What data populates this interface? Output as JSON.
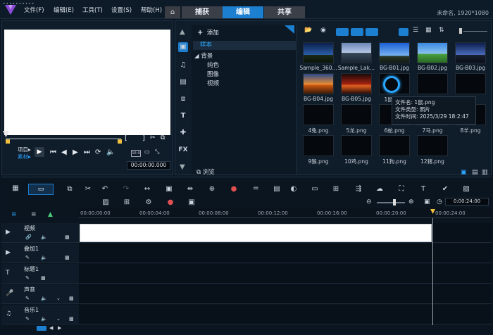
{
  "menubar": {
    "items": [
      "文件(F)",
      "编辑(E)",
      "工具(T)",
      "设置(S)",
      "帮助(H)"
    ],
    "home_icon": "⌂",
    "tabs": [
      "捕获",
      "编辑",
      "共享"
    ],
    "project_info": "未命名, 1920*1080"
  },
  "preview": {
    "mode_project": "项目▸",
    "mode_clip": "素材▸",
    "timecode": "00:00:00.000",
    "grip": "••••••••••",
    "bracket_in": "[",
    "bracket_out": "]"
  },
  "library": {
    "add_label": "添加",
    "tree": [
      "样本",
      "背景",
      "纯色",
      "图像",
      "视频"
    ],
    "browse_label": "浏览",
    "items": [
      {
        "name": "Sample_360...",
        "kind": "sky"
      },
      {
        "name": "Sample_Lak...",
        "kind": "lake"
      },
      {
        "name": "BG-B01.jpg",
        "kind": "blue"
      },
      {
        "name": "BG-B02.jpg",
        "kind": "green"
      },
      {
        "name": "BG-B03.jpg",
        "kind": "dusk"
      },
      {
        "name": "BG-B04.jpg",
        "kind": "orange"
      },
      {
        "name": "BG-B05.jpg",
        "kind": "red"
      },
      {
        "name": "1鼠.png",
        "kind": "dark"
      },
      {
        "name": "",
        "kind": "dark"
      },
      {
        "name": "",
        "kind": "dark"
      },
      {
        "name": "4兔.png",
        "kind": "dark"
      },
      {
        "name": "5龙.png",
        "kind": "dark"
      },
      {
        "name": "6蛇.png",
        "kind": "dark"
      },
      {
        "name": "7马.png",
        "kind": "dark"
      },
      {
        "name": "8羊.png",
        "kind": "dark"
      },
      {
        "name": "9猴.png",
        "kind": "dark"
      },
      {
        "name": "10鸡.png",
        "kind": "dark"
      },
      {
        "name": "11狗.png",
        "kind": "dark"
      },
      {
        "name": "12猪.png",
        "kind": "dark"
      }
    ],
    "tooltip": {
      "line1": "文件名: 1鼠.png",
      "line2": "文件类型: 照片",
      "line3": "文件时间: 2025/3/29 18:2:47"
    }
  },
  "timeline": {
    "timecode": "0:00:24:00",
    "ruler": [
      "00:00:00:00",
      "00:00:04:00",
      "00:00:08:00",
      "00:00:12:00",
      "00:00:16:00",
      "00:00:20:00",
      "00:00:24:00"
    ],
    "tracks": [
      "视频",
      "叠加1",
      "标题1",
      "声音",
      "音乐1"
    ]
  },
  "colors": {
    "accent": "#1d7fd0",
    "highlight": "#2ca6ff",
    "trim": "#f0c040"
  }
}
